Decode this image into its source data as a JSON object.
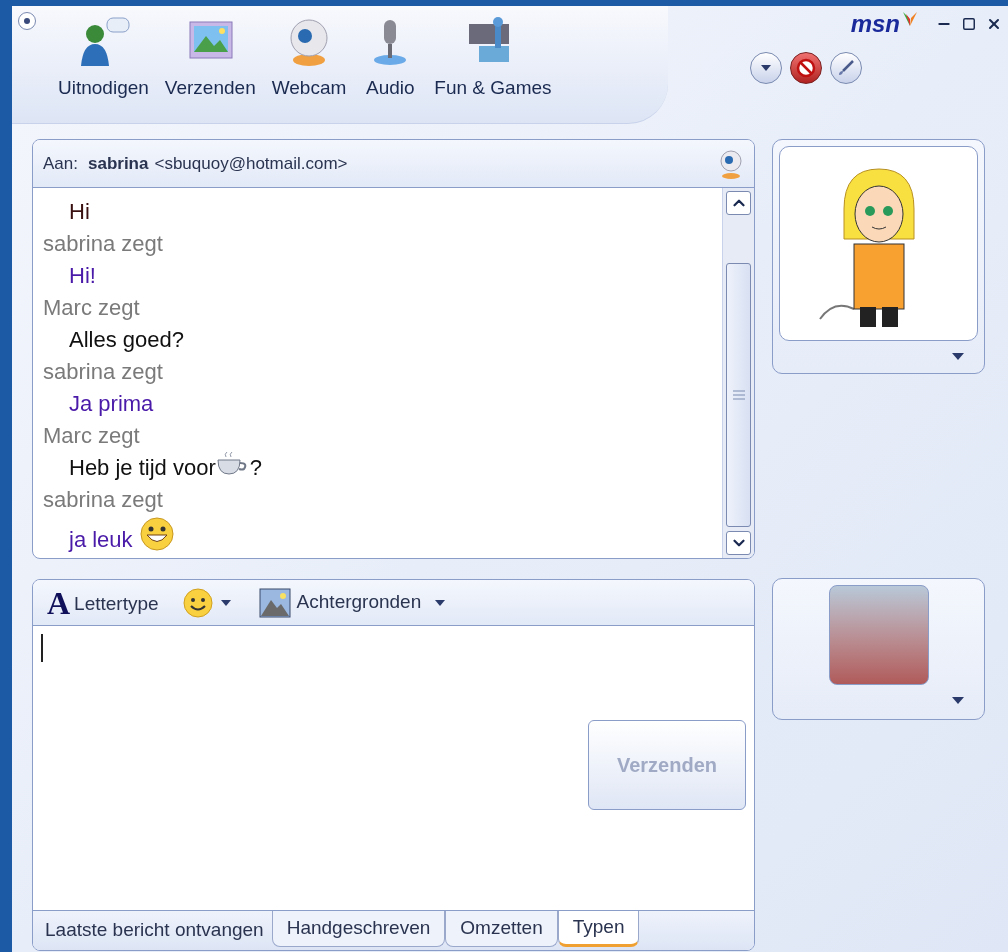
{
  "toolbar": {
    "buttons": [
      {
        "label": "Uitnodigen",
        "kind": "invite"
      },
      {
        "label": "Verzenden",
        "kind": "picture"
      },
      {
        "label": "Webcam",
        "kind": "webcam"
      },
      {
        "label": "Audio",
        "kind": "audio"
      },
      {
        "label": "Fun & Games",
        "kind": "games"
      }
    ]
  },
  "logo": {
    "text": "msn"
  },
  "chat": {
    "to_label": "Aan:",
    "contact_name": "sabrina",
    "contact_email": "<sbuquoy@hotmail.com>",
    "lines": [
      {
        "kind": "message",
        "color": "#3a1010",
        "parts": [
          {
            "kind": "text",
            "text": "Hi"
          }
        ]
      },
      {
        "kind": "sender",
        "text": "sabrina zegt"
      },
      {
        "kind": "message",
        "color": "#4a1aa8",
        "parts": [
          {
            "kind": "text",
            "text": "Hi!"
          }
        ]
      },
      {
        "kind": "sender",
        "text": "Marc zegt"
      },
      {
        "kind": "message",
        "color": "#111111",
        "parts": [
          {
            "kind": "text",
            "text": "Alles goed?"
          }
        ]
      },
      {
        "kind": "sender",
        "text": "sabrina zegt"
      },
      {
        "kind": "message",
        "color": "#4a1aa8",
        "parts": [
          {
            "kind": "text",
            "text": "Ja prima"
          }
        ]
      },
      {
        "kind": "sender",
        "text": "Marc zegt"
      },
      {
        "kind": "message",
        "color": "#111111",
        "parts": [
          {
            "kind": "text",
            "text": "Heb je tijd voor"
          },
          {
            "kind": "coffee"
          },
          {
            "kind": "text",
            "text": "?"
          }
        ]
      },
      {
        "kind": "sender",
        "text": "sabrina zegt"
      },
      {
        "kind": "message",
        "color": "#4a1aa8",
        "parts": [
          {
            "kind": "text",
            "text": "ja leuk "
          },
          {
            "kind": "smiley"
          }
        ]
      }
    ]
  },
  "compose": {
    "font_glyph": "A",
    "font_label": "Lettertype",
    "backgrounds_label": "Achtergronden",
    "send_button": {
      "label": "Verzenden",
      "disabled": true
    },
    "status": "Laatste bericht ontvangen",
    "tabs": [
      {
        "label": "Handgeschreven",
        "selected": false
      },
      {
        "label": "Omzetten",
        "selected": false
      },
      {
        "label": "Typen",
        "selected": true
      }
    ]
  }
}
